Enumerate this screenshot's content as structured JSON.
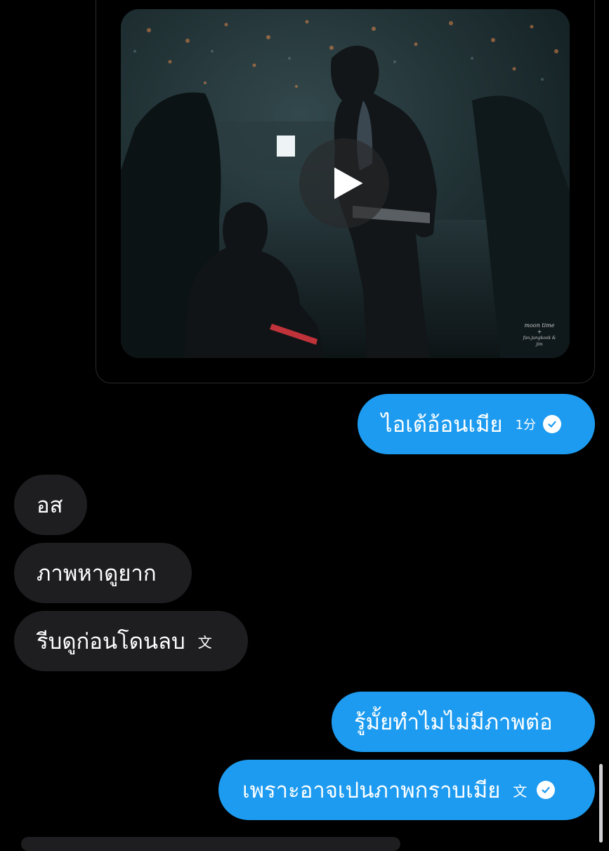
{
  "video": {
    "play_label": "Play video",
    "watermark_line1": "moon time",
    "watermark_line2": "+",
    "watermark_line3": "fan.jungkook & jim"
  },
  "messages": [
    {
      "side": "out",
      "text": "ไอเต้อ้อนเมีย",
      "time": "1分",
      "status": "read"
    },
    {
      "side": "in",
      "text": "อส"
    },
    {
      "side": "in",
      "text": "ภาพหาดูยาก"
    },
    {
      "side": "in",
      "text": "รีบดูก่อนโดนลบ",
      "translated_icon": "文"
    },
    {
      "side": "out",
      "text": "รู้มั้ยทำไมไม่มีภาพต่อ"
    },
    {
      "side": "out",
      "text": "เพราะอาจเปนภาพกราบเมีย",
      "translated_icon": "文",
      "status": "read"
    }
  ],
  "colors": {
    "outgoing_bubble": "#1d9bf0",
    "incoming_bubble": "#1e1e20",
    "background": "#000000"
  }
}
